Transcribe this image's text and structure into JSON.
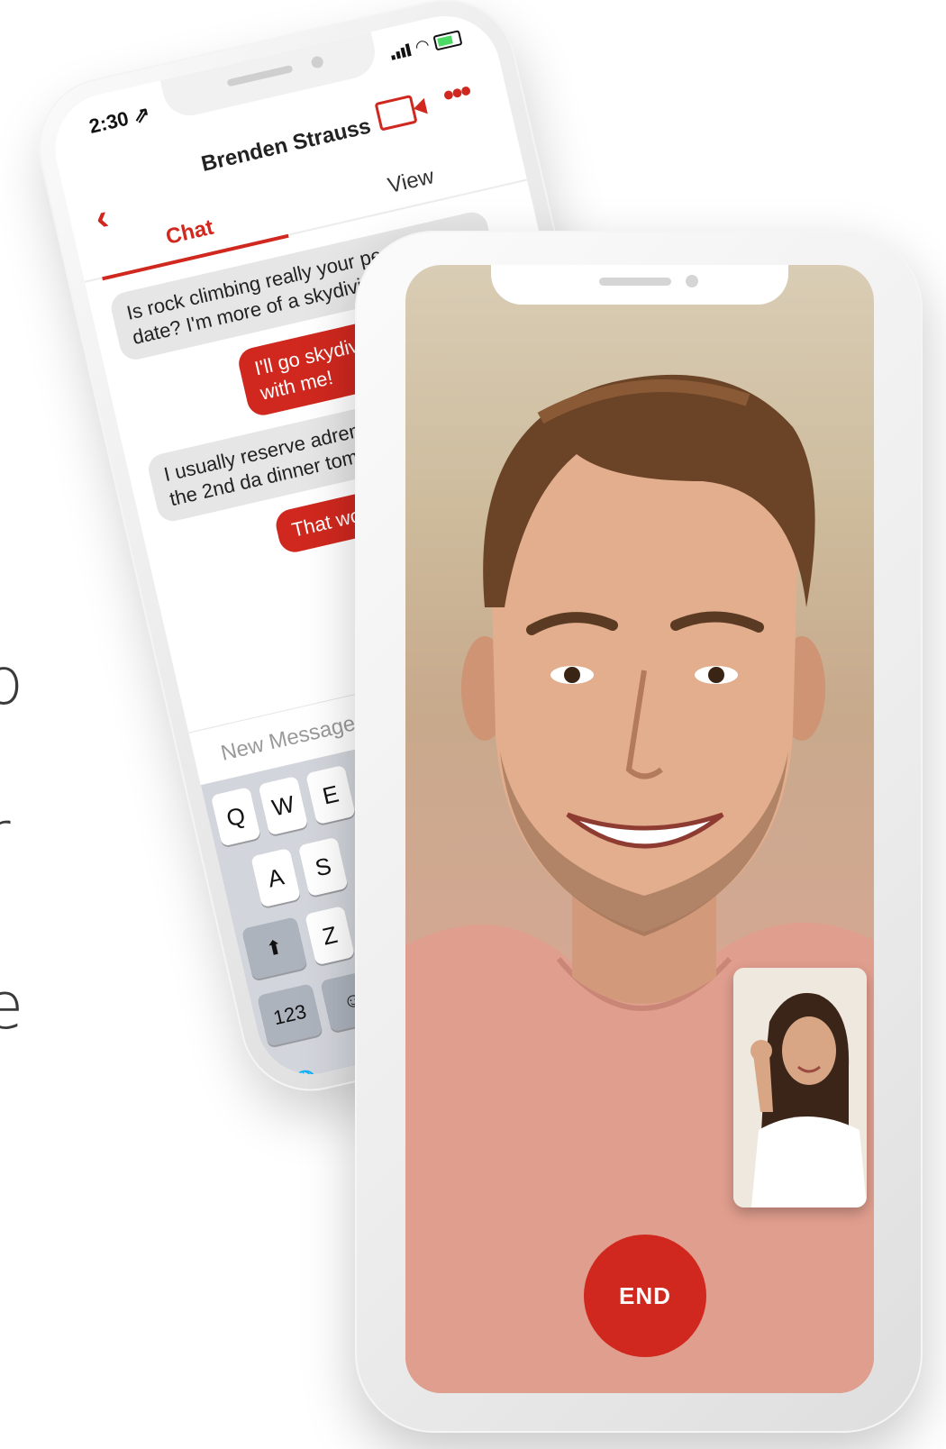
{
  "edge_letters": [
    "o",
    "r",
    "e"
  ],
  "chat_phone": {
    "status_time": "2:30 ⇗",
    "contact_name": "Brenden Strauss",
    "tabs": {
      "chat": "Chat",
      "view": "View"
    },
    "messages": [
      {
        "dir": "in",
        "text": "Is rock climbing really your perfect first date? I'm more of a skydiving ki"
      },
      {
        "dir": "out",
        "text": "I'll go skydiving wit climbing with me!"
      },
      {
        "dir": "in",
        "text": "I usually reserve adrenal activities for the 2nd da dinner tomorrow?"
      },
      {
        "dir": "out",
        "text": "That works f in mind?"
      }
    ],
    "compose_placeholder": "New Message",
    "keyboard": {
      "row1": [
        "Q",
        "W",
        "E"
      ],
      "row2": [
        "A",
        "S"
      ],
      "row3": [
        "⬆",
        "Z"
      ],
      "row4": [
        "123",
        "☺"
      ],
      "globe": "🌐"
    },
    "icons": [
      "chevron-left-icon",
      "video-camera-icon",
      "more-options-icon",
      "signal-icon",
      "wifi-icon",
      "battery-icon",
      "globe-icon"
    ]
  },
  "video_phone": {
    "end_label": "END"
  },
  "colors": {
    "accent": "#d0281e",
    "bubble_in": "#e6e6e6",
    "keyboard_bg": "#d2d5db"
  }
}
